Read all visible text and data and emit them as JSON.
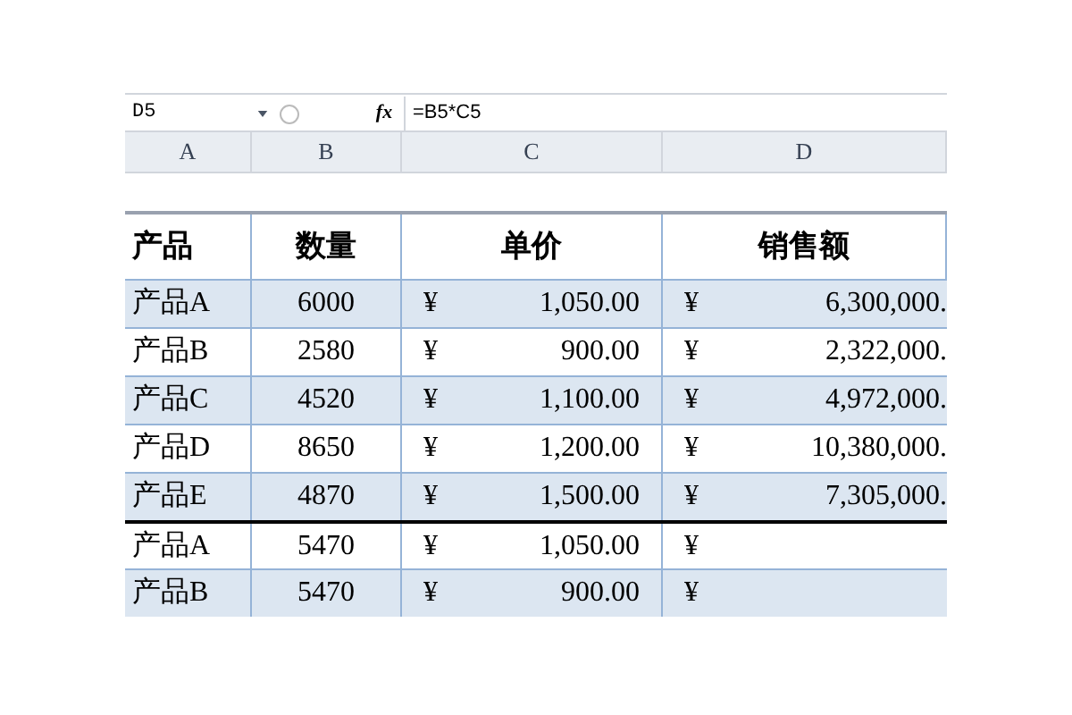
{
  "formula_bar": {
    "name_box": "D5",
    "fx": "fx",
    "formula": "=B5*C5"
  },
  "column_headers": [
    "A",
    "B",
    "C",
    "D"
  ],
  "table": {
    "columns": [
      "产品",
      "数量",
      "单价",
      "销售额"
    ],
    "rows": [
      {
        "product": "产品A",
        "qty": "6000",
        "price_symbol": "¥",
        "price": "1,050.00",
        "sales_symbol": "¥",
        "sales": "6,300,000.",
        "shaded": true,
        "divider_above": false
      },
      {
        "product": "产品B",
        "qty": "2580",
        "price_symbol": "¥",
        "price": "900.00",
        "sales_symbol": "¥",
        "sales": "2,322,000.",
        "shaded": false,
        "divider_above": false
      },
      {
        "product": "产品C",
        "qty": "4520",
        "price_symbol": "¥",
        "price": "1,100.00",
        "sales_symbol": "¥",
        "sales": "4,972,000.",
        "shaded": true,
        "divider_above": false
      },
      {
        "product": "产品D",
        "qty": "8650",
        "price_symbol": "¥",
        "price": "1,200.00",
        "sales_symbol": "¥",
        "sales": "10,380,000.",
        "shaded": false,
        "divider_above": false
      },
      {
        "product": "产品E",
        "qty": "4870",
        "price_symbol": "¥",
        "price": "1,500.00",
        "sales_symbol": "¥",
        "sales": "7,305,000.",
        "shaded": true,
        "divider_above": false
      },
      {
        "product": "产品A",
        "qty": "5470",
        "price_symbol": "¥",
        "price": "1,050.00",
        "sales_symbol": "¥",
        "shaded": false,
        "divider_above": true
      },
      {
        "product": "产品B",
        "qty": "5470",
        "price_symbol": "¥",
        "price": "900.00",
        "sales_symbol": "¥",
        "shaded": true,
        "divider_above": false
      }
    ]
  }
}
